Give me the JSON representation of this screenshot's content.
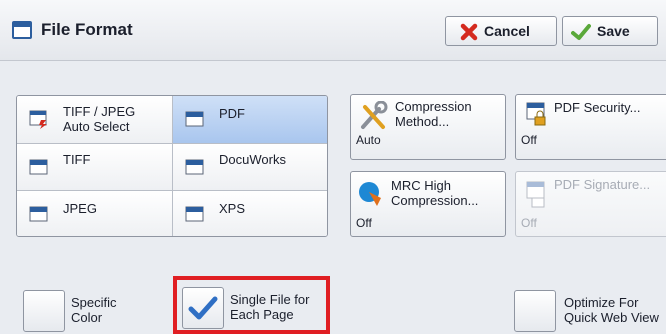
{
  "header": {
    "title": "File Format",
    "cancel_label": "Cancel",
    "save_label": "Save",
    "icons": [
      "file-format-icon",
      "x-icon",
      "checkmark-icon"
    ]
  },
  "formats": [
    {
      "line1": "TIFF / JPEG",
      "line2": "Auto Select",
      "icon": "tiff-jpeg-auto-icon"
    },
    {
      "line1": "PDF",
      "line2": "",
      "icon": "pdf-file-icon",
      "selected": true
    },
    {
      "line1": "TIFF",
      "line2": "",
      "icon": "tiff-file-icon"
    },
    {
      "line1": "DocuWorks",
      "line2": "",
      "icon": "docuworks-file-icon"
    },
    {
      "line1": "JPEG",
      "line2": "",
      "icon": "jpeg-file-icon"
    },
    {
      "line1": "XPS",
      "line2": "",
      "icon": "xps-file-icon"
    }
  ],
  "options": {
    "compression": {
      "line1": "Compression",
      "line2": "Method...",
      "value": "Auto",
      "icon": "tools-icon"
    },
    "pdf_security": {
      "line1": "PDF Security...",
      "value": "Off",
      "icon": "lock-document-icon"
    },
    "mrc": {
      "line1": "MRC High",
      "line2": "Compression...",
      "value": "Off",
      "icon": "mrc-icon"
    },
    "pdf_signature": {
      "line1": "PDF Signature...",
      "value": "Off",
      "icon": "signature-document-icon",
      "disabled": true
    }
  },
  "checkboxes": {
    "specific_color": {
      "line1": "Specific",
      "line2": "Color",
      "checked": false
    },
    "single_file": {
      "line1": "Single File for",
      "line2": "Each Page",
      "checked": true
    },
    "quick_web_view": {
      "line1": "Optimize For",
      "line2": "Quick Web View",
      "checked": false
    }
  },
  "colors": {
    "highlight": "#e01e23",
    "selected": "#a9c6ee",
    "accent": "#2c5e9e"
  }
}
